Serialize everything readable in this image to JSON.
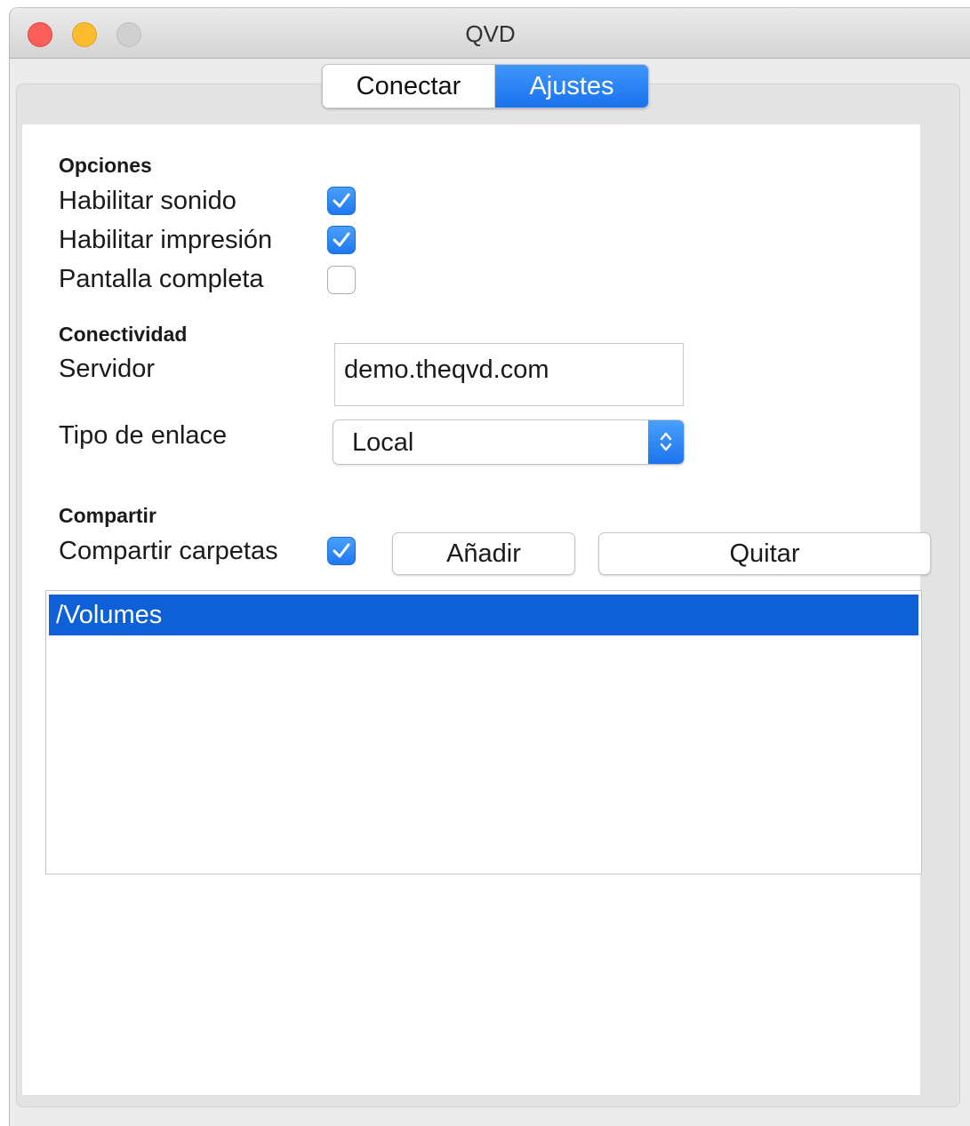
{
  "window": {
    "title": "QVD"
  },
  "tabs": [
    {
      "label": "Conectar",
      "active": false
    },
    {
      "label": "Ajustes",
      "active": true
    }
  ],
  "options": {
    "heading": "Opciones",
    "items": [
      {
        "label": "Habilitar sonido",
        "checked": true
      },
      {
        "label": "Habilitar impresión",
        "checked": true
      },
      {
        "label": "Pantalla completa",
        "checked": false
      }
    ]
  },
  "connectivity": {
    "heading": "Conectividad",
    "server_label": "Servidor",
    "server_value": "demo.theqvd.com",
    "link_type_label": "Tipo de enlace",
    "link_type_value": "Local"
  },
  "sharing": {
    "heading": "Compartir",
    "share_label": "Compartir carpetas",
    "share_checked": true,
    "add_button": "Añadir",
    "remove_button": "Quitar",
    "folders": [
      "/Volumes"
    ]
  },
  "colors": {
    "accent": "#1a72ee",
    "selection": "#0f5fd6",
    "close": "#fc5f57",
    "minimize": "#fdbc2e"
  }
}
